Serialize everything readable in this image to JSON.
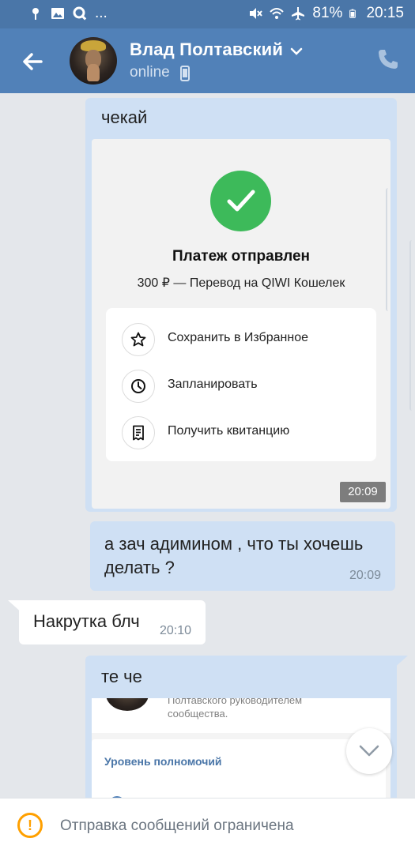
{
  "status_bar": {
    "battery": "81%",
    "time": "20:15",
    "ellipsis": "..."
  },
  "header": {
    "contact_name": "Влад Полтавский",
    "status": "online"
  },
  "messages": [
    {
      "direction": "out",
      "text": "чекай"
    },
    {
      "direction": "out",
      "text": "а зач адиминoм , что ты хочешь делать ?",
      "time": "20:09"
    },
    {
      "direction": "in",
      "text": "Накрутка блч",
      "time": "20:10"
    },
    {
      "direction": "out",
      "text": "те че"
    }
  ],
  "payment_card": {
    "title": "Платеж отправлен",
    "subtitle": "300 ₽ — Перевод на QIWI Кошелек",
    "actions": [
      {
        "label": "Сохранить в Избранное",
        "icon": "star-icon"
      },
      {
        "label": "Запланировать",
        "icon": "clock-icon"
      },
      {
        "label": "Получить квитанцию",
        "icon": "receipt-icon"
      }
    ],
    "time": "20:09"
  },
  "second_card": {
    "text_line1": "Полтавского руководителем",
    "text_line2": "сообщества.",
    "panel_title": "Уровень полномочий"
  },
  "notice": {
    "text": "Отправка сообщений ограничена"
  },
  "colors": {
    "header": "#5181b8",
    "status_bar": "#4a76a8",
    "outgoing_bubble": "#cfe0f4",
    "success": "#3dba5a",
    "warning": "#ffa000"
  }
}
